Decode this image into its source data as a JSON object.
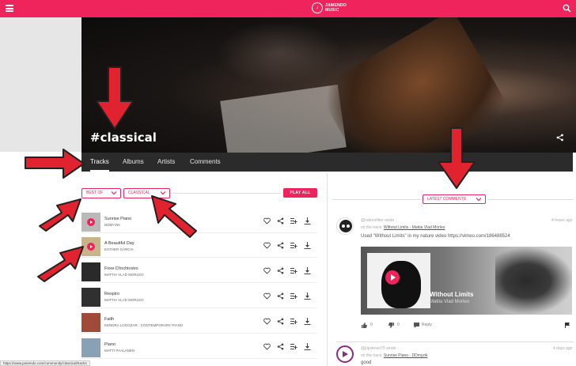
{
  "header": {
    "logo_line1": "JAMENDO",
    "logo_line2": "MUSIC"
  },
  "hero": {
    "title": "#classical"
  },
  "tabs": [
    {
      "label": "Tracks",
      "active": true
    },
    {
      "label": "Albums"
    },
    {
      "label": "Artists"
    },
    {
      "label": "Comments"
    }
  ],
  "filters": {
    "sort": "BEST OF",
    "genre": "CLASSICAL",
    "play_all": "PLAY ALL"
  },
  "tracks": [
    {
      "title": "Sunrise Piano",
      "artist": "DDMYZIK"
    },
    {
      "title": "A Beautiful Day",
      "artist": "ESTHER GARCIA"
    },
    {
      "title": "Fiore D'inchiostro",
      "artist": "MATTIA VLAD MORLEO"
    },
    {
      "title": "Respiro",
      "artist": "MATTIA VLAD MORLEO"
    },
    {
      "title": "Faith",
      "artist": "KENDRA LOGOZAR - CONTEMPORARY PIANO"
    },
    {
      "title": "Piano",
      "artist": "MATTI PAALANEN"
    }
  ],
  "comments": {
    "select": "LATEST COMMENTS",
    "items": [
      {
        "user": "@naturefilter wrote :",
        "time": "4 hours ago",
        "on_track_prefix": "on the track:",
        "track_link": "Without Limits - Mattia Vlad Morleo",
        "text": "Used \"Without Limits\" in my nature video https://vimeo.com/186488524",
        "embed_title": "Without Limits",
        "embed_artist": "Mattia Vlad Morleo",
        "likes": "0",
        "dislikes": "0",
        "reply": "Reply"
      },
      {
        "user": "@jojo4ever70 wrote :",
        "time": "4 days ago",
        "on_track_prefix": "on the track:",
        "track_link": "Sunrise Piano - DDmyzik",
        "text": "good"
      }
    ]
  },
  "statusbar": {
    "url": "https://www.jamendo.com/community/classical/tracks"
  },
  "colors": {
    "accent": "#f0245c",
    "tabbar": "#2b2b2b"
  }
}
